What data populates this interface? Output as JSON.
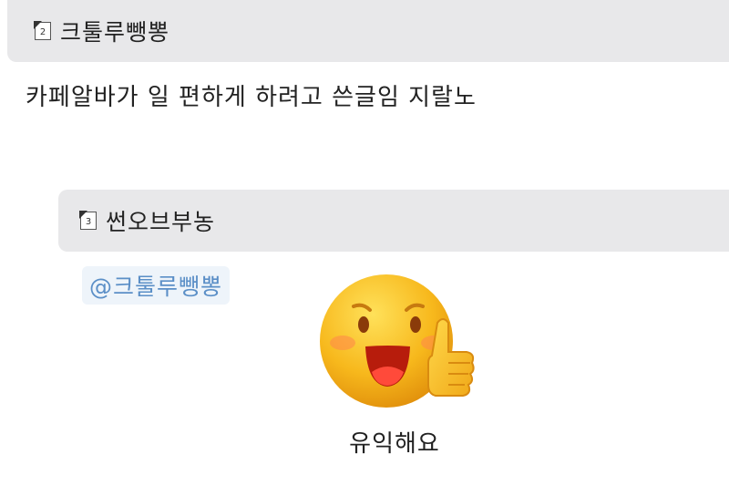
{
  "comment": {
    "level": "2",
    "nickname": "크툴루뺑뽕",
    "text": "카페알바가 일 편하게 하려고 쓴글임 지랄노"
  },
  "reply": {
    "level": "3",
    "nickname": "썬오브부농",
    "mention": "@크툴루뺑뽕",
    "emoticon": {
      "icon": "thumbs-up-smiley-icon",
      "caption": "유익해요"
    }
  },
  "colors": {
    "header_bg": "#e8e8ea",
    "mention_text": "#5b8fc7",
    "mention_bg": "#eef4fa",
    "emoticon_face": "#f7b81c"
  }
}
